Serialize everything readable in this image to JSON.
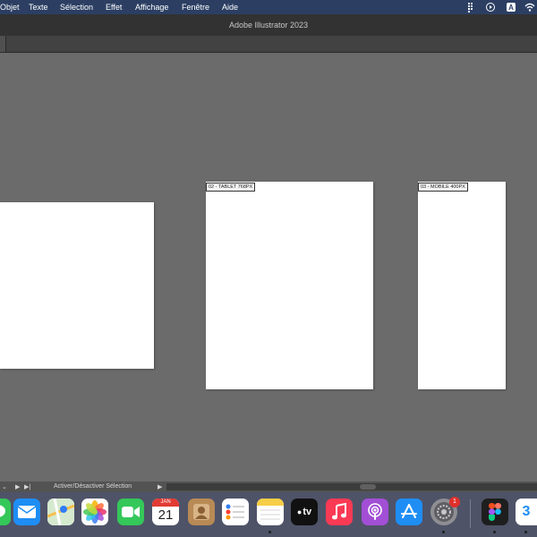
{
  "menubar": {
    "items": [
      "Objet",
      "Texte",
      "Sélection",
      "Effet",
      "Affichage",
      "Fenêtre",
      "Aide"
    ],
    "status_icons": [
      "grid-icon",
      "play-circle-icon",
      "keyboard-input-a-icon",
      "wifi-icon"
    ]
  },
  "titlebar": {
    "title": "Adobe Illustrator 2023"
  },
  "artboards": [
    {
      "name": ""
    },
    {
      "name": "02 - TABLET 768PX"
    },
    {
      "name": "03 - MOBILE 400PX"
    }
  ],
  "statusbar": {
    "nav_symbols": [
      "⌄",
      "▶",
      "▶|"
    ],
    "label": "Activer/Désactiver Sélection",
    "arrow_right": "▶",
    "arrow_left": "◀"
  },
  "dock": {
    "apps": [
      "messages-icon",
      "mail-icon",
      "maps-icon",
      "photos-icon",
      "facetime-icon",
      "calendar-icon",
      "contacts-icon",
      "reminders-icon",
      "notes-icon",
      "apple-tv-icon",
      "music-icon",
      "podcasts-icon",
      "app-store-icon",
      "system-settings-icon",
      "figma-icon",
      "partial-app-icon"
    ],
    "calendar": {
      "month": "JAN",
      "day": "21"
    },
    "tv_label": "tv",
    "settings_badge": "1",
    "partial_glyph": "3"
  },
  "colors": {
    "menubar_bg": "#2c3f63",
    "canvas_bg": "#6b6b6b",
    "dock_bg": "#4f5368",
    "badge_red": "#e0302b"
  }
}
